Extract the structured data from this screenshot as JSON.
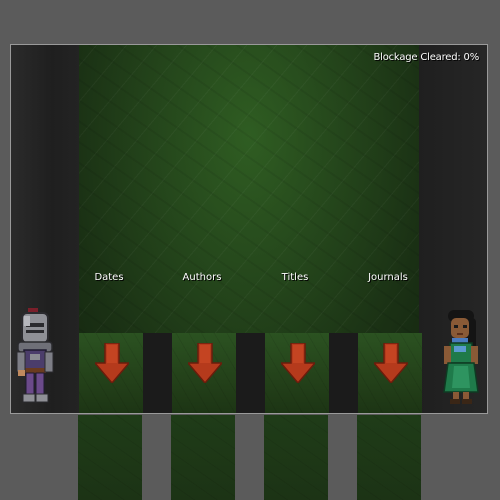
{
  "hud": {
    "blockage_label": "Blockage Cleared: 0%"
  },
  "columns": [
    {
      "label": "Dates"
    },
    {
      "label": "Authors"
    },
    {
      "label": "Titles"
    },
    {
      "label": "Journals"
    }
  ],
  "characters": {
    "left": "armored-knight",
    "right": "green-dress-heroine"
  },
  "colors": {
    "background": "#5b5b5b",
    "arena_green": "#24451b",
    "arrow_red": "#b53a1c",
    "text": "#ffffff"
  },
  "icons": {
    "column_arrow": "down-arrow-icon"
  }
}
